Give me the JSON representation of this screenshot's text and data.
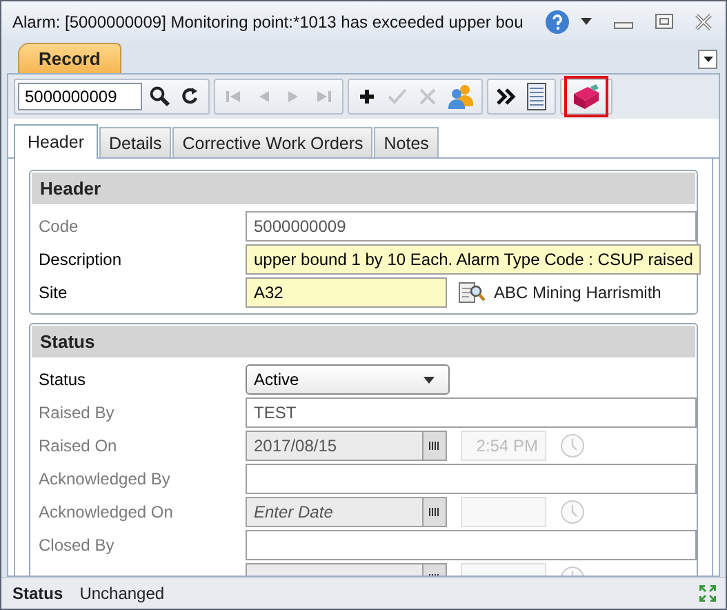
{
  "window": {
    "title": "Alarm: [5000000009] Monitoring point:*1013 has exceeded upper bou"
  },
  "ribbon_tabs": [
    {
      "label": "Record",
      "selected": true
    }
  ],
  "toolbar": {
    "search_value": "5000000009",
    "groups": [
      [
        {
          "kind": "search",
          "disabled": false,
          "highlighted": false
        },
        {
          "kind": "refresh",
          "disabled": false,
          "highlighted": false
        }
      ],
      [
        {
          "kind": "first",
          "disabled": true,
          "highlighted": false
        },
        {
          "kind": "previous",
          "disabled": true,
          "highlighted": false
        },
        {
          "kind": "next",
          "disabled": true,
          "highlighted": false
        },
        {
          "kind": "last",
          "disabled": true,
          "highlighted": false
        }
      ],
      [
        {
          "kind": "add",
          "disabled": false,
          "highlighted": false
        },
        {
          "kind": "save",
          "disabled": true,
          "highlighted": false
        },
        {
          "kind": "cancel",
          "disabled": true,
          "highlighted": false
        },
        {
          "kind": "users",
          "disabled": false,
          "highlighted": false
        }
      ],
      [
        {
          "kind": "more",
          "disabled": false,
          "highlighted": false
        },
        {
          "kind": "list",
          "disabled": false,
          "highlighted": false
        }
      ],
      [
        {
          "kind": "toolbox",
          "disabled": false,
          "highlighted": true
        }
      ]
    ]
  },
  "tabs": [
    {
      "label": "Header",
      "selected": true
    },
    {
      "label": "Details",
      "selected": false
    },
    {
      "label": "Corrective Work Orders",
      "selected": false
    },
    {
      "label": "Notes",
      "selected": false
    }
  ],
  "sections": [
    {
      "title": "Header",
      "fields": [
        {
          "kind": "text",
          "label": "Code",
          "value": "5000000009",
          "disabled": true,
          "required": false
        },
        {
          "kind": "text",
          "label": "Description",
          "value": "upper bound 1 by 10 Each. Alarm Type Code : CSUP raised",
          "disabled": false,
          "required": true
        },
        {
          "kind": "lookup",
          "label": "Site",
          "value": "A32",
          "lookup_text": "ABC Mining Harrismith",
          "disabled": false,
          "required": true
        }
      ]
    },
    {
      "title": "Status",
      "fields": [
        {
          "kind": "dropdown",
          "label": "Status",
          "value": "Active",
          "disabled": false,
          "required": false
        },
        {
          "kind": "text",
          "label": "Raised By",
          "value": "TEST",
          "disabled": true,
          "required": false
        },
        {
          "kind": "datetime",
          "label": "Raised On",
          "value": "2017/08/15",
          "time": "2:54 PM",
          "disabled": true,
          "required": false
        },
        {
          "kind": "text",
          "label": "Acknowledged By",
          "disabled": true,
          "required": false
        },
        {
          "kind": "datetime",
          "label": "Acknowledged On",
          "placeholder": "Enter Date",
          "disabled": true,
          "required": false
        },
        {
          "kind": "text",
          "label": "Closed By",
          "disabled": true,
          "required": false
        },
        {
          "kind": "datetime",
          "disabled": true,
          "required": false
        }
      ]
    }
  ],
  "status_bar": {
    "label": "Status",
    "value": "Unchanged"
  }
}
